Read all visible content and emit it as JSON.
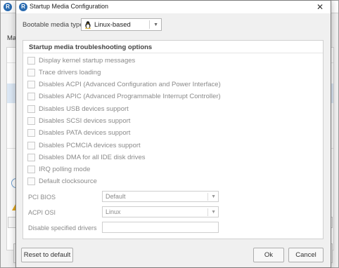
{
  "background_window": {
    "title": "R",
    "menu_label": "Ma"
  },
  "dialog": {
    "title": "Startup Media Configuration",
    "close_glyph": "✕"
  },
  "media_type": {
    "label": "Bootable media type",
    "value": "Linux-based"
  },
  "troubleshooting": {
    "title": "Startup media troubleshooting options",
    "options": [
      {
        "label": "Display kernel startup messages",
        "checked": false
      },
      {
        "label": "Trace drivers loading",
        "checked": false
      },
      {
        "label": "Disables ACPI (Advanced Configuration and Power Interface)",
        "checked": false
      },
      {
        "label": "Disables APIC (Advanced Programmable Interrupt Controller)",
        "checked": false
      },
      {
        "label": "Disables USB devices support",
        "checked": false
      },
      {
        "label": "Disables SCSI devices support",
        "checked": false
      },
      {
        "label": "Disables PATA devices support",
        "checked": false
      },
      {
        "label": "Disables PCMCIA devices support",
        "checked": false
      },
      {
        "label": "Disables DMA for all IDE disk drives",
        "checked": false
      },
      {
        "label": "IRQ polling mode",
        "checked": false
      },
      {
        "label": "Default clocksource",
        "checked": false
      }
    ],
    "pci_bios": {
      "label": "PCI BIOS",
      "value": "Default"
    },
    "acpi_osi": {
      "label": "ACPI OSI",
      "value": "Linux"
    },
    "disable_drivers": {
      "label": "Disable specified drivers",
      "value": ""
    }
  },
  "buttons": {
    "reset": "Reset to default",
    "ok": "Ok",
    "cancel": "Cancel"
  },
  "icons": {
    "app_logo": "app-logo-icon",
    "linux": "linux-penguin-icon",
    "dropdown": "chevron-down-icon",
    "close": "close-icon",
    "warning": "warning-icon"
  },
  "colors": {
    "accent": "#2a6bb0",
    "selection": "#dce8f5"
  }
}
